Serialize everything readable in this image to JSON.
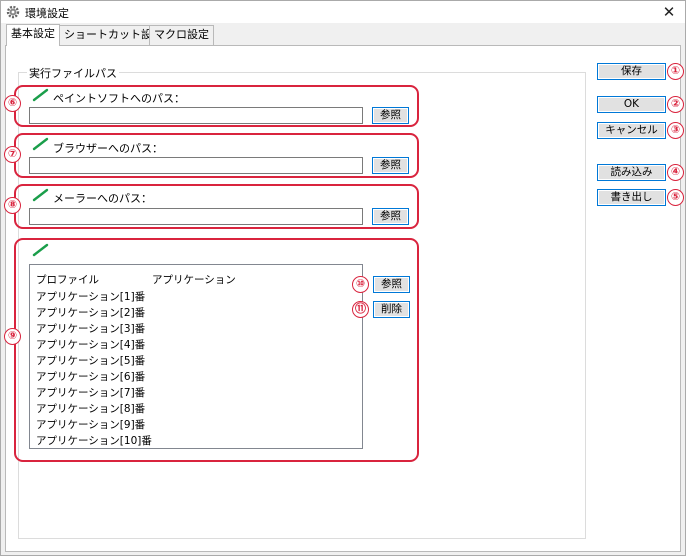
{
  "window": {
    "title": "環境設定"
  },
  "tabs": [
    {
      "label": "基本設定"
    },
    {
      "label": "ショートカット設定"
    },
    {
      "label": "マクロ設定"
    }
  ],
  "group": {
    "label": "実行ファイルパス"
  },
  "paths": [
    {
      "label": "ペイントソフトへのパス：",
      "value": "",
      "browse": "参照",
      "badge": "⑥"
    },
    {
      "label": "ブラウザーへのパス：",
      "value": "",
      "browse": "参照",
      "badge": "⑦"
    },
    {
      "label": "メーラーへのパス：",
      "value": "",
      "browse": "参照",
      "badge": "⑧"
    }
  ],
  "apps": {
    "badge": "⑨",
    "columns": [
      "プロファイル",
      "アプリケーション"
    ],
    "rows": [
      {
        "profile": "アプリケーション[1]番",
        "app": ""
      },
      {
        "profile": "アプリケーション[2]番",
        "app": ""
      },
      {
        "profile": "アプリケーション[3]番",
        "app": ""
      },
      {
        "profile": "アプリケーション[4]番",
        "app": ""
      },
      {
        "profile": "アプリケーション[5]番",
        "app": ""
      },
      {
        "profile": "アプリケーション[6]番",
        "app": ""
      },
      {
        "profile": "アプリケーション[7]番",
        "app": ""
      },
      {
        "profile": "アプリケーション[8]番",
        "app": ""
      },
      {
        "profile": "アプリケーション[9]番",
        "app": ""
      },
      {
        "profile": "アプリケーション[10]番",
        "app": ""
      }
    ],
    "browse": {
      "label": "参照",
      "badge": "⑩"
    },
    "delete": {
      "label": "削除",
      "badge": "⑪"
    }
  },
  "side_buttons": [
    {
      "label": "保存",
      "badge": "①"
    },
    {
      "label": "OK",
      "badge": "②"
    },
    {
      "label": "キャンセル",
      "badge": "③"
    },
    {
      "label": "読み込み",
      "badge": "④"
    },
    {
      "label": "書き出し",
      "badge": "⑤"
    }
  ],
  "colors": {
    "annotation": "#d9243e",
    "accent": "#0078d7",
    "pencil": "#1a9e4a"
  },
  "icons": {
    "title": "gear-icon",
    "close": "close-icon",
    "pencil": "pencil-icon"
  }
}
